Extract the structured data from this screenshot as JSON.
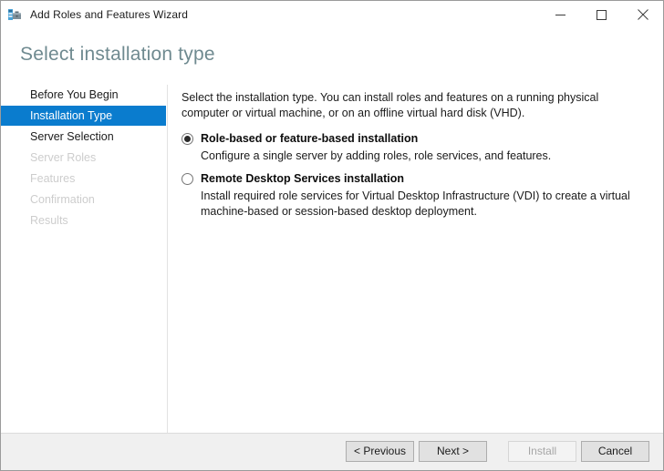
{
  "window": {
    "title": "Add Roles and Features Wizard",
    "icon": "server-wizard-icon",
    "controls": {
      "minimize": "minimize-icon",
      "maximize": "maximize-icon",
      "close": "close-icon"
    }
  },
  "heading": "Select installation type",
  "nav": {
    "items": [
      {
        "label": "Before You Begin",
        "state": "normal"
      },
      {
        "label": "Installation Type",
        "state": "selected"
      },
      {
        "label": "Server Selection",
        "state": "normal"
      },
      {
        "label": "Server Roles",
        "state": "disabled"
      },
      {
        "label": "Features",
        "state": "disabled"
      },
      {
        "label": "Confirmation",
        "state": "disabled"
      },
      {
        "label": "Results",
        "state": "disabled"
      }
    ]
  },
  "content": {
    "intro": "Select the installation type. You can install roles and features on a running physical computer or virtual machine, or on an offline virtual hard disk (VHD).",
    "options": [
      {
        "label": "Role-based or feature-based installation",
        "description": "Configure a single server by adding roles, role services, and features.",
        "checked": true
      },
      {
        "label": "Remote Desktop Services installation",
        "description": "Install required role services for Virtual Desktop Infrastructure (VDI) to create a virtual machine-based or session-based desktop deployment.",
        "checked": false
      }
    ]
  },
  "footer": {
    "previous": "< Previous",
    "next": "Next >",
    "install": "Install",
    "cancel": "Cancel",
    "install_disabled": true
  },
  "colors": {
    "accent_selected": "#0a7cce",
    "heading": "#6f8a90",
    "disabled_text": "#cdcdcd",
    "footer_bg": "#f0f0f0"
  }
}
